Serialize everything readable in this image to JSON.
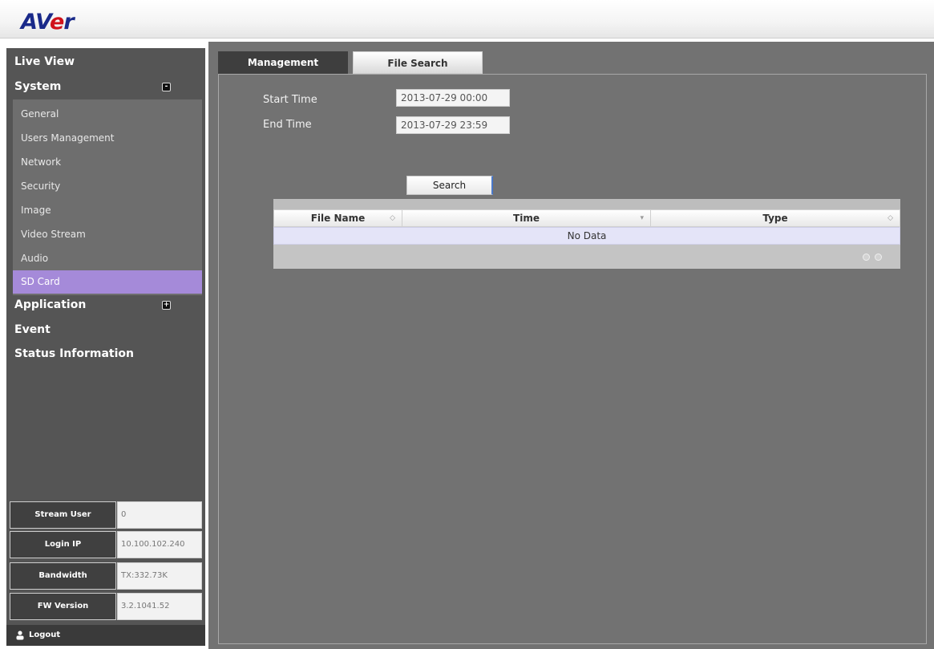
{
  "header": {
    "logo_main": "AV",
    "logo_accent": "e",
    "logo_end": "r"
  },
  "sidebar": {
    "menu": [
      {
        "label": "Live View"
      },
      {
        "label": "System",
        "toggle": "-"
      },
      {
        "label": "Application",
        "toggle": "+"
      },
      {
        "label": "Event"
      },
      {
        "label": "Status Information"
      }
    ],
    "system_items": [
      {
        "label": "General"
      },
      {
        "label": "Users Management"
      },
      {
        "label": "Network"
      },
      {
        "label": "Security"
      },
      {
        "label": "Image"
      },
      {
        "label": "Video Stream"
      },
      {
        "label": "Audio"
      },
      {
        "label": "SD Card",
        "active": true
      }
    ],
    "info": [
      {
        "label": "Stream User",
        "value": "0"
      },
      {
        "label": "Login IP",
        "value": "10.100.102.240"
      },
      {
        "label": "Bandwidth",
        "value": "TX:332.73K"
      },
      {
        "label": "FW Version",
        "value": "3.2.1041.52"
      }
    ],
    "logout_label": "Logout"
  },
  "main": {
    "tabs": [
      {
        "label": "Management"
      },
      {
        "label": "File Search",
        "active": true
      }
    ],
    "start_time_label": "Start Time",
    "start_time_value": "2013-07-29 00:00",
    "end_time_label": "End Time",
    "end_time_value": "2013-07-29 23:59",
    "search_label": "Search",
    "table": {
      "columns": [
        "File Name",
        "Time",
        "Type"
      ],
      "empty_text": "No Data"
    }
  },
  "colors": {
    "sidebar": "#555555",
    "main_bg": "#727272",
    "active_item": "#a58ad9",
    "logo_blue": "#1a2a8a",
    "logo_red": "#d0121b"
  }
}
